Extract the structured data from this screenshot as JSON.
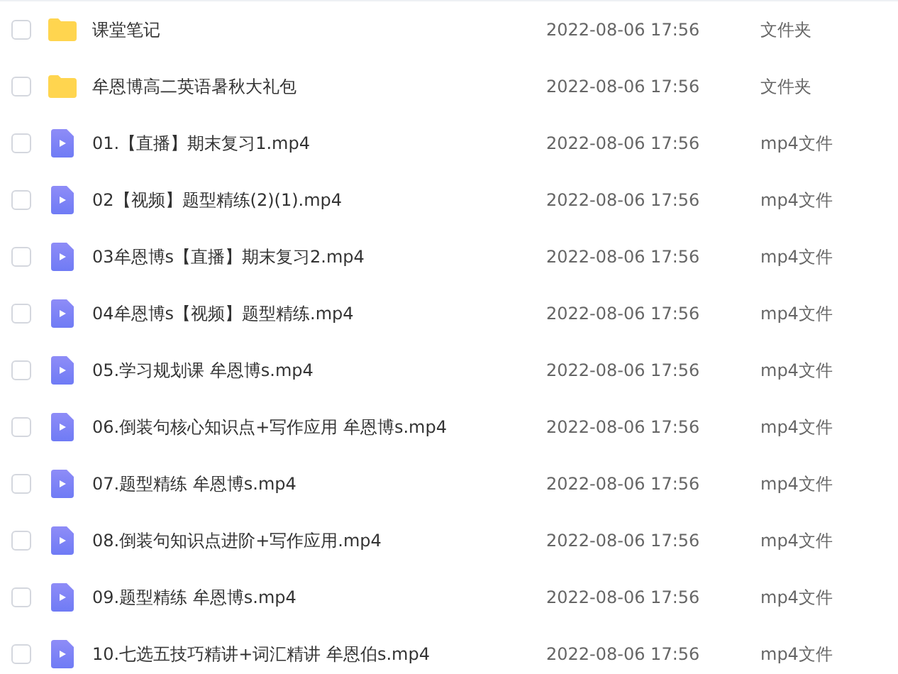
{
  "files": [
    {
      "kind": "folder",
      "name": "课堂笔记",
      "date": "2022-08-06 17:56",
      "type": "文件夹",
      "checked": false
    },
    {
      "kind": "folder",
      "name": "牟恩博高二英语暑秋大礼包",
      "date": "2022-08-06 17:56",
      "type": "文件夹",
      "checked": false
    },
    {
      "kind": "video",
      "name": "01.【直播】期末复习1.mp4",
      "date": "2022-08-06 17:56",
      "type": "mp4文件",
      "checked": false
    },
    {
      "kind": "video",
      "name": "02【视频】题型精练(2)(1).mp4",
      "date": "2022-08-06 17:56",
      "type": "mp4文件",
      "checked": false
    },
    {
      "kind": "video",
      "name": "03牟恩博s【直播】期末复习2.mp4",
      "date": "2022-08-06 17:56",
      "type": "mp4文件",
      "checked": false
    },
    {
      "kind": "video",
      "name": "04牟恩博s【视频】题型精练.mp4",
      "date": "2022-08-06 17:56",
      "type": "mp4文件",
      "checked": false
    },
    {
      "kind": "video",
      "name": "05.学习规划课 牟恩博s.mp4",
      "date": "2022-08-06 17:56",
      "type": "mp4文件",
      "checked": false
    },
    {
      "kind": "video",
      "name": "06.倒装句核心知识点+写作应用 牟恩博s.mp4",
      "date": "2022-08-06 17:56",
      "type": "mp4文件",
      "checked": false
    },
    {
      "kind": "video",
      "name": "07.题型精练 牟恩博s.mp4",
      "date": "2022-08-06 17:56",
      "type": "mp4文件",
      "checked": false
    },
    {
      "kind": "video",
      "name": "08.倒装句知识点进阶+写作应用.mp4",
      "date": "2022-08-06 17:56",
      "type": "mp4文件",
      "checked": false
    },
    {
      "kind": "video",
      "name": "09.题型精练 牟恩博s.mp4",
      "date": "2022-08-06 17:56",
      "type": "mp4文件",
      "checked": false
    },
    {
      "kind": "video",
      "name": "10.七选五技巧精讲+词汇精讲 牟恩伯s.mp4",
      "date": "2022-08-06 17:56",
      "type": "mp4文件",
      "checked": false
    }
  ]
}
